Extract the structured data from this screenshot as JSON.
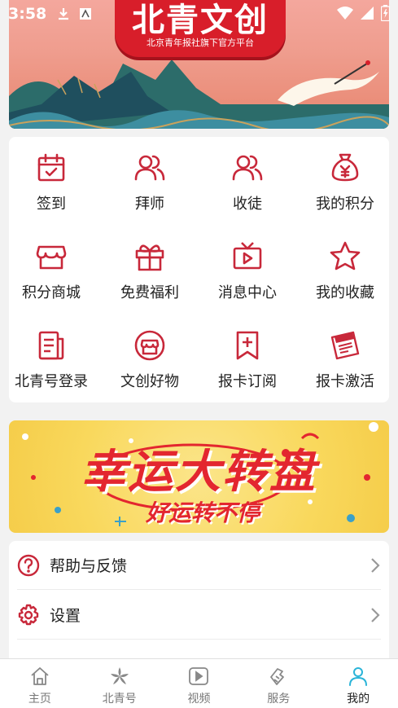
{
  "status_bar": {
    "time": "3:58"
  },
  "banner": {
    "title": "北青文创",
    "subtitle": "北京青年报社旗下官方平台"
  },
  "menu": {
    "items": [
      {
        "label": "签到",
        "icon": "calendar-check-icon"
      },
      {
        "label": "拜师",
        "icon": "users-icon"
      },
      {
        "label": "收徒",
        "icon": "users-icon"
      },
      {
        "label": "我的积分",
        "icon": "money-bag-icon"
      },
      {
        "label": "积分商城",
        "icon": "store-icon"
      },
      {
        "label": "免费福利",
        "icon": "gift-icon"
      },
      {
        "label": "消息中心",
        "icon": "tv-icon"
      },
      {
        "label": "我的收藏",
        "icon": "star-icon"
      },
      {
        "label": "北青号登录",
        "icon": "document-icon"
      },
      {
        "label": "文创好物",
        "icon": "shop-icon"
      },
      {
        "label": "报卡订阅",
        "icon": "bookmark-plus-icon"
      },
      {
        "label": "报卡激活",
        "icon": "newspaper-icon"
      }
    ]
  },
  "wheel_banner": {
    "title": "幸运大转盘",
    "subtitle": "好运转不停"
  },
  "list": {
    "help": "帮助与反馈",
    "settings": "设置"
  },
  "nav": {
    "items": [
      {
        "label": "主页",
        "icon": "home-icon"
      },
      {
        "label": "北青号",
        "icon": "flower-icon"
      },
      {
        "label": "视频",
        "icon": "video-icon"
      },
      {
        "label": "服务",
        "icon": "service-icon"
      },
      {
        "label": "我的",
        "icon": "person-icon"
      }
    ],
    "active": "我的"
  },
  "colors": {
    "accent": "#c8283a",
    "active_nav": "#2bb4d8",
    "nav_gray": "#888888"
  }
}
